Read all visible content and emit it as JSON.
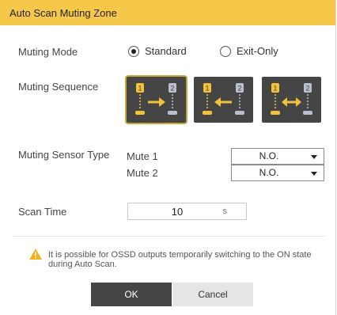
{
  "dialog": {
    "title": "Auto Scan Muting Zone",
    "muting_mode": {
      "label": "Muting Mode",
      "options": [
        "Standard",
        "Exit-Only"
      ],
      "selected": "Standard"
    },
    "muting_sequence": {
      "label": "Muting Sequence",
      "options": [
        {
          "from": "1",
          "to": "2",
          "direction": "right",
          "selected": true
        },
        {
          "from": "1",
          "to": "2",
          "direction": "left",
          "selected": false
        },
        {
          "from": "1",
          "to": "2",
          "direction": "both",
          "selected": false
        }
      ]
    },
    "muting_sensor_type": {
      "label": "Muting Sensor Type",
      "mute1": {
        "label": "Mute 1",
        "value": "N.O."
      },
      "mute2": {
        "label": "Mute 2",
        "value": "N.O."
      }
    },
    "scan_time": {
      "label": "Scan Time",
      "value": "10",
      "unit": "s"
    },
    "warning": "It is possible for OSSD outputs temporarily switching to the ON state during Auto Scan.",
    "buttons": {
      "ok": "OK",
      "cancel": "Cancel"
    },
    "colors": {
      "title_bar": "#f6c84a",
      "sequence_bg": "#454545",
      "accent": "#f2c23a",
      "warning": "#f3b320"
    }
  }
}
